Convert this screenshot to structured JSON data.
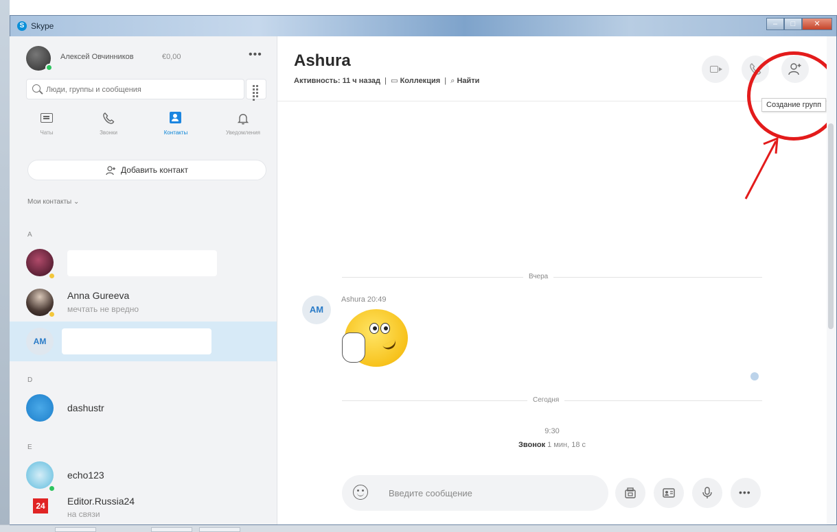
{
  "window": {
    "title": "Skype"
  },
  "profile": {
    "name": "Алексей Овчинников",
    "balance": "€0,00"
  },
  "search": {
    "placeholder": "Люди, группы и сообщения"
  },
  "nav": [
    {
      "label": "Чаты",
      "icon": "chat-icon"
    },
    {
      "label": "Звонки",
      "icon": "phone-icon"
    },
    {
      "label": "Контакты",
      "icon": "contacts-icon"
    },
    {
      "label": "Уведомления",
      "icon": "bell-icon"
    }
  ],
  "add_contact": {
    "label": "Добавить контакт"
  },
  "contacts_header": {
    "label": "Мои контакты",
    "chevron": "⌄"
  },
  "sections": [
    "A",
    "D",
    "E"
  ],
  "contacts": [
    {
      "name": "",
      "status": ""
    },
    {
      "name": "Anna Gureeva",
      "status": "мечтать не вредно"
    },
    {
      "name": "",
      "status": "",
      "initials": "AM"
    },
    {
      "name": "dashustr",
      "status": ""
    },
    {
      "name": "echo123",
      "status": ""
    },
    {
      "name": "Editor.Russia24",
      "status": "на связи",
      "badge": "24"
    }
  ],
  "conversation": {
    "title": "Ashura",
    "activity": "Активность: 11 ч назад",
    "collection": "Коллекция",
    "find": "Найти",
    "tooltip": "Создание групп"
  },
  "messages": {
    "divider_yesterday": "Вчера",
    "divider_today": "Сегодня",
    "sender_initials": "AM",
    "sender_meta": "Ashura 20:49",
    "call_time": "9:30",
    "call_label": "Звонок",
    "call_duration": "1 мин, 18 с"
  },
  "composer": {
    "placeholder": "Введите сообщение"
  },
  "colors": {
    "accent": "#0a84d6",
    "highlight": "#e31b1b",
    "selected_row": "#d7eaf7"
  }
}
